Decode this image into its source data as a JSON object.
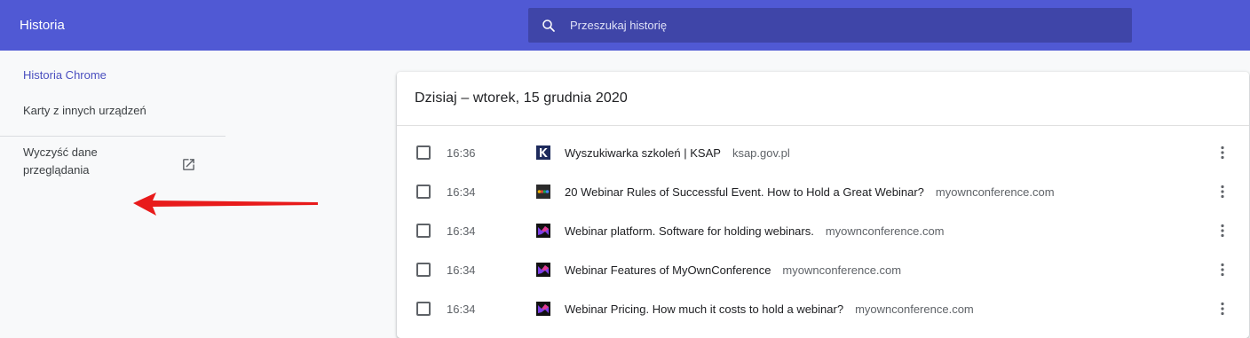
{
  "header": {
    "title": "Historia",
    "search_placeholder": "Przeszukaj historię"
  },
  "sidebar": {
    "items": [
      {
        "label": "Historia Chrome",
        "active": true
      },
      {
        "label": "Karty z innych urządzeń",
        "active": false
      }
    ],
    "clear_browsing_data": "Wyczyść dane przeglądania"
  },
  "history": {
    "date_header": "Dzisiaj – wtorek, 15 grudnia 2020",
    "entries": [
      {
        "time": "16:36",
        "title": "Wyszukiwarka szkoleń | KSAP",
        "domain": "ksap.gov.pl",
        "favicon": "ksap-favicon"
      },
      {
        "time": "16:34",
        "title": "20 Webinar Rules of Successful Event. How to Hold a Great Webinar?",
        "domain": "myownconference.com",
        "favicon": "colorful-dots-favicon"
      },
      {
        "time": "16:34",
        "title": "Webinar platform. Software for holding webinars.",
        "domain": "myownconference.com",
        "favicon": "myownconference-favicon"
      },
      {
        "time": "16:34",
        "title": "Webinar Features of MyOwnConference",
        "domain": "myownconference.com",
        "favicon": "myownconference-favicon"
      },
      {
        "time": "16:34",
        "title": "Webinar Pricing. How much it costs to hold a webinar?",
        "domain": "myownconference.com",
        "favicon": "myownconference-favicon"
      }
    ]
  },
  "colors": {
    "header_bg": "#5059d4",
    "search_bg": "#3f45a8",
    "active_link": "#4a4fbf",
    "annotation_arrow": "#e81b1b"
  }
}
